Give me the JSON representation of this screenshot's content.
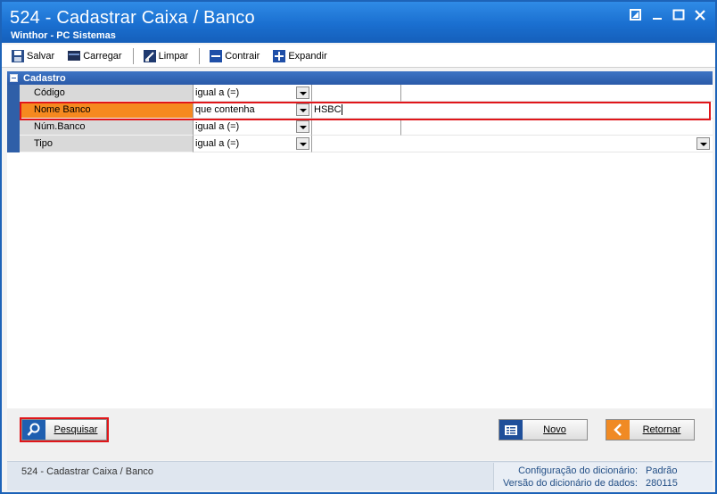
{
  "window": {
    "title": "524 - Cadastrar Caixa / Banco",
    "subtitle": "Winthor - PC Sistemas"
  },
  "toolbar": {
    "items": [
      {
        "label": "Salvar",
        "icon": "save-icon"
      },
      {
        "label": "Carregar",
        "icon": "load-icon"
      },
      {
        "label": "Limpar",
        "icon": "clear-icon"
      },
      {
        "label": "Contrair",
        "icon": "collapse-icon"
      },
      {
        "label": "Expandir",
        "icon": "expand-icon"
      }
    ]
  },
  "grid": {
    "category": "Cadastro",
    "rows": [
      {
        "label": "Código",
        "operator": "igual a (=)",
        "value": ""
      },
      {
        "label": "Nome Banco",
        "operator": "que contenha",
        "value": "HSBC"
      },
      {
        "label": "Núm.Banco",
        "operator": "igual a (=)",
        "value": ""
      },
      {
        "label": "Tipo",
        "operator": "igual a (=)",
        "value": ""
      }
    ]
  },
  "buttons": {
    "search": "Pesquisar",
    "new": "Novo",
    "back": "Retornar"
  },
  "status": {
    "left": "524 - Cadastrar Caixa / Banco",
    "config_label": "Configuração do dicionário:",
    "config_value": "Padrão",
    "version_label": "Versão do dicionário de dados:",
    "version_value": "280115"
  },
  "colors": {
    "titlebar": "#1a6fd0",
    "selected_row": "#f6891f",
    "highlight": "#e0161a"
  }
}
